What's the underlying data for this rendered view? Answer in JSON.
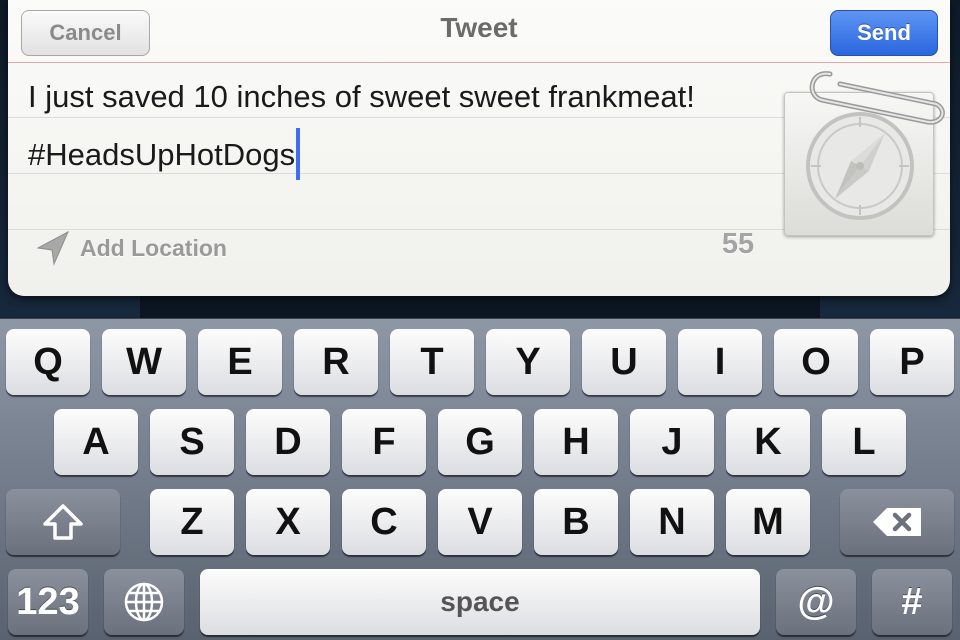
{
  "compose": {
    "cancel_label": "Cancel",
    "title": "Tweet",
    "send_label": "Send",
    "text_line1": "I just saved 10 inches of sweet sweet frankmeat!",
    "text_line2": "#HeadsUpHotDogs",
    "location_label": "Add Location",
    "char_count": "55",
    "attachment_icon": "safari-compass-icon"
  },
  "keyboard": {
    "row1": [
      "Q",
      "W",
      "E",
      "R",
      "T",
      "Y",
      "U",
      "I",
      "O",
      "P"
    ],
    "row2": [
      "A",
      "S",
      "D",
      "F",
      "G",
      "H",
      "J",
      "K",
      "L"
    ],
    "row3": [
      "Z",
      "X",
      "C",
      "V",
      "B",
      "N",
      "M"
    ],
    "numbers_label": "123",
    "space_label": "space",
    "at_label": "@",
    "hash_label": "#",
    "shift_icon": "shift-icon",
    "delete_icon": "delete-icon",
    "globe_icon": "globe-icon"
  },
  "colors": {
    "send_button": "#2a66de",
    "cursor": "#3f6cf5"
  }
}
